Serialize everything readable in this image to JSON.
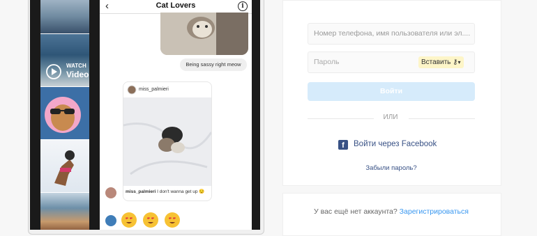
{
  "phone": {
    "feed": {
      "watch_label": "WATCH",
      "video_label": "Video"
    },
    "chat": {
      "title": "Cat Lovers",
      "back_icon": "chevron-left-icon",
      "info_icon": "info-icon",
      "sent_message": "Being sassy right meow",
      "shared_post": {
        "author": "miss_palmieri",
        "caption_user": "miss_palmieri",
        "caption_text": "I don't wanna get up 😒"
      },
      "emoji_icon": "heart-eyes-cat-emoji"
    }
  },
  "login": {
    "username_placeholder": "Номер телефона, имя пользователя или эл....",
    "password_placeholder": "Пароль",
    "paste_label": "Вставить",
    "login_button": "Войти",
    "or_text": "ИЛИ",
    "facebook_label": "Войти через Facebook",
    "forgot_password": "Забыли пароль?",
    "accent_color": "#3897f0",
    "facebook_color": "#385185"
  },
  "signup": {
    "prompt": "У вас ещё нет аккаунта?",
    "link": "Зарегистрироваться"
  }
}
